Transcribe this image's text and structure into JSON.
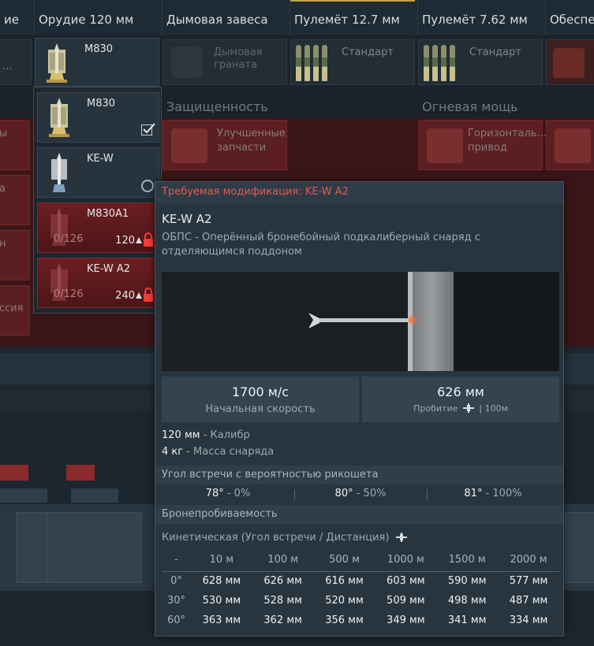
{
  "header": {
    "columns": [
      "ие",
      "Орудие 120 мм",
      "Дымовая завеса",
      "Пулемёт 12.7 мм",
      "Пулемёт 7.62 мм",
      "Обеспе"
    ]
  },
  "row1": {
    "left_dots": "...",
    "smoke_name": "Дымовая граната",
    "mg127_name": "Стандарт",
    "mg762_name": "Стандарт"
  },
  "sections": {
    "protection": "Защищенность",
    "firepower": "Огневая мощь"
  },
  "red_cells": {
    "left_labels": [
      "ы",
      "а",
      "н",
      "ссия"
    ],
    "spare_parts": "Улучшенные запчасти",
    "horizontal_drive": "Горизонталь... привод"
  },
  "ammo": {
    "current": "M830",
    "items": [
      {
        "name": "M830",
        "state": "selected"
      },
      {
        "name": "KE-W",
        "state": "available"
      },
      {
        "name": "M830A1",
        "state": "locked",
        "count": "0/126",
        "cost": "120"
      },
      {
        "name": "KE-W A2",
        "state": "locked",
        "count": "0/126",
        "cost": "240"
      }
    ]
  },
  "tooltip": {
    "required_mod": "Требуемая модификация: KE-W A2",
    "title": "KE-W A2",
    "description": "ОБПС - Оперённый бронебойный подкалиберный снаряд с отделяющимся поддоном",
    "velocity_value": "1700 м/с",
    "velocity_label": "Начальная скорость",
    "penetration_value": "626 мм",
    "penetration_label": "Пробитие",
    "penetration_dist": "| 100м",
    "caliber_value": "120 мм",
    "caliber_label": " - Калибр",
    "mass_value": "4 кг",
    "mass_label": " - Масса снаряда",
    "ricochet_title": "Угол встречи с вероятностью рикошета",
    "ricochet": [
      {
        "angle": "78°",
        "chance": " - 0%"
      },
      {
        "angle": "80°",
        "chance": " - 50%"
      },
      {
        "angle": "81°",
        "chance": " - 100%"
      }
    ],
    "armor_title": "Бронепробиваемость",
    "kinetic_label": "Кинетическая (Угол встречи / Дистанция)",
    "table": {
      "headers": [
        "-",
        "10 м",
        "100 м",
        "500 м",
        "1000 м",
        "1500 м",
        "2000 м"
      ],
      "rows": [
        [
          "0°",
          "628 мм",
          "626 мм",
          "616 мм",
          "603 мм",
          "590 мм",
          "577 мм"
        ],
        [
          "30°",
          "530 мм",
          "528 мм",
          "520 мм",
          "509 мм",
          "498 мм",
          "487 мм"
        ],
        [
          "60°",
          "363 мм",
          "362 мм",
          "356 мм",
          "349 мм",
          "341 мм",
          "334 мм"
        ]
      ]
    }
  },
  "colors": {
    "required_red": "#e45a52",
    "locked_red": "#6b1e22",
    "panel_bg": "#28353f"
  }
}
